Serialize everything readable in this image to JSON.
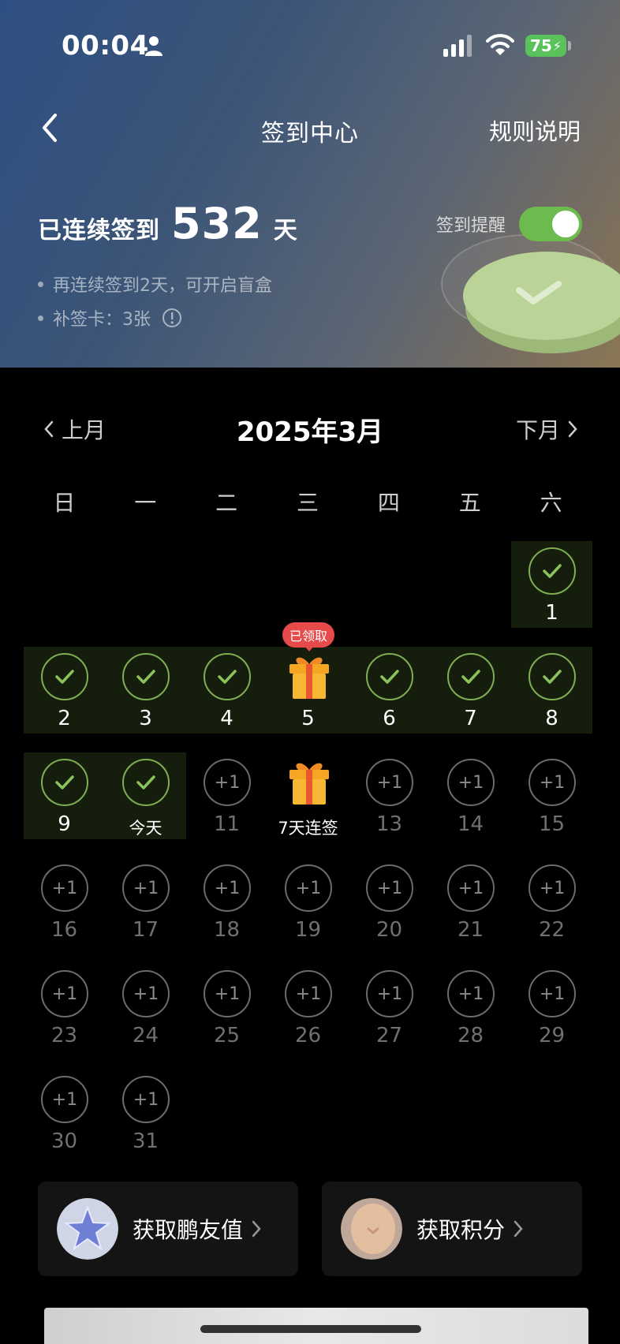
{
  "status_bar": {
    "time": "00:04",
    "battery": "75"
  },
  "header": {
    "title": "签到中心",
    "rules_link": "规则说明"
  },
  "streak": {
    "label": "已连续签到",
    "days": "532",
    "unit": "天"
  },
  "reminder": {
    "label": "签到提醒",
    "enabled": true
  },
  "tips": [
    "再连续签到2天，可开启盲盒",
    "补签卡：3张"
  ],
  "calendar": {
    "prev_label": "上月",
    "next_label": "下月",
    "month_title": "2025年3月",
    "weekdays": [
      "日",
      "一",
      "二",
      "三",
      "四",
      "五",
      "六"
    ],
    "claimed_badge": "已领取",
    "bonus_text": "+1",
    "days": [
      {
        "label": "1",
        "state": "done"
      },
      {
        "label": "2",
        "state": "done"
      },
      {
        "label": "3",
        "state": "done"
      },
      {
        "label": "4",
        "state": "done"
      },
      {
        "label": "5",
        "state": "gift-claimed"
      },
      {
        "label": "6",
        "state": "done"
      },
      {
        "label": "7",
        "state": "done"
      },
      {
        "label": "8",
        "state": "done"
      },
      {
        "label": "9",
        "state": "done"
      },
      {
        "label": "今天",
        "state": "done"
      },
      {
        "label": "11",
        "state": "future"
      },
      {
        "label": "7天连签",
        "state": "gift"
      },
      {
        "label": "13",
        "state": "future"
      },
      {
        "label": "14",
        "state": "future"
      },
      {
        "label": "15",
        "state": "future"
      },
      {
        "label": "16",
        "state": "future"
      },
      {
        "label": "17",
        "state": "future"
      },
      {
        "label": "18",
        "state": "future"
      },
      {
        "label": "19",
        "state": "future"
      },
      {
        "label": "20",
        "state": "future"
      },
      {
        "label": "21",
        "state": "future"
      },
      {
        "label": "22",
        "state": "future"
      },
      {
        "label": "23",
        "state": "future"
      },
      {
        "label": "24",
        "state": "future"
      },
      {
        "label": "25",
        "state": "future"
      },
      {
        "label": "26",
        "state": "future"
      },
      {
        "label": "27",
        "state": "future"
      },
      {
        "label": "28",
        "state": "future"
      },
      {
        "label": "29",
        "state": "future"
      },
      {
        "label": "30",
        "state": "future"
      },
      {
        "label": "31",
        "state": "future"
      }
    ]
  },
  "cards": [
    {
      "label": "获取鹏友值",
      "icon": "star-crystal-icon"
    },
    {
      "label": "获取积分",
      "icon": "coin-icon"
    }
  ],
  "colors": {
    "accent_green": "#6dbb4f",
    "badge_red": "#e64a4a"
  }
}
